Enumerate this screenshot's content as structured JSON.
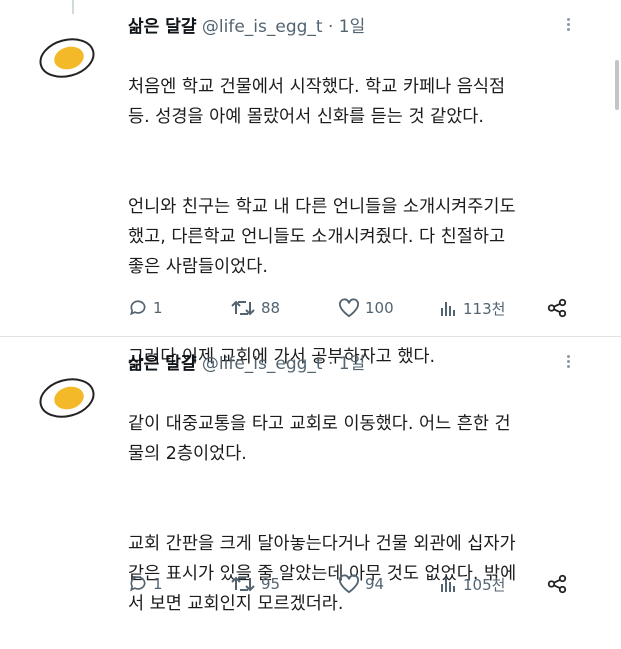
{
  "colors": {
    "text": "#0f1419",
    "muted": "#536471",
    "divider": "#dfe3e6",
    "yolk": "#f4b928"
  },
  "tweets": [
    {
      "name": "삶은 달걀",
      "handle": "@life_is_egg_t",
      "dot": "·",
      "time": "1일",
      "avatar_icon": "boiled-egg-avatar",
      "paragraphs": [
        "처음엔 학교 건물에서 시작했다. 학교 카페나 음식점\n등. 성경을 아예 몰랐어서 신화를 듣는 것 같았다.",
        "언니와 친구는 학교 내 다른 언니들을 소개시켜주기도\n했고, 다른학교 언니들도 소개시켜줬다. 다 친절하고\n좋은 사람들이었다.",
        "그러다 이제 교회에 가서 공부하자고 했다."
      ],
      "replies": "1",
      "retweets": "88",
      "likes": "100",
      "views": "113천"
    },
    {
      "name": "삶은 달걀",
      "handle": "@life_is_egg_t",
      "dot": "·",
      "time": "1일",
      "avatar_icon": "boiled-egg-avatar",
      "paragraphs": [
        "같이 대중교통을 타고 교회로 이동했다. 어느 흔한 건\n물의 2층이었다.",
        "교회 간판을 크게 달아놓는다거나 건물 외관에 십자가\n같은 표시가 있을 줄 알았는데 아무 것도 없었다. 밖에\n서 보면 교회인지 모르겠더라."
      ],
      "replies": "1",
      "retweets": "95",
      "likes": "94",
      "views": "105천"
    }
  ]
}
